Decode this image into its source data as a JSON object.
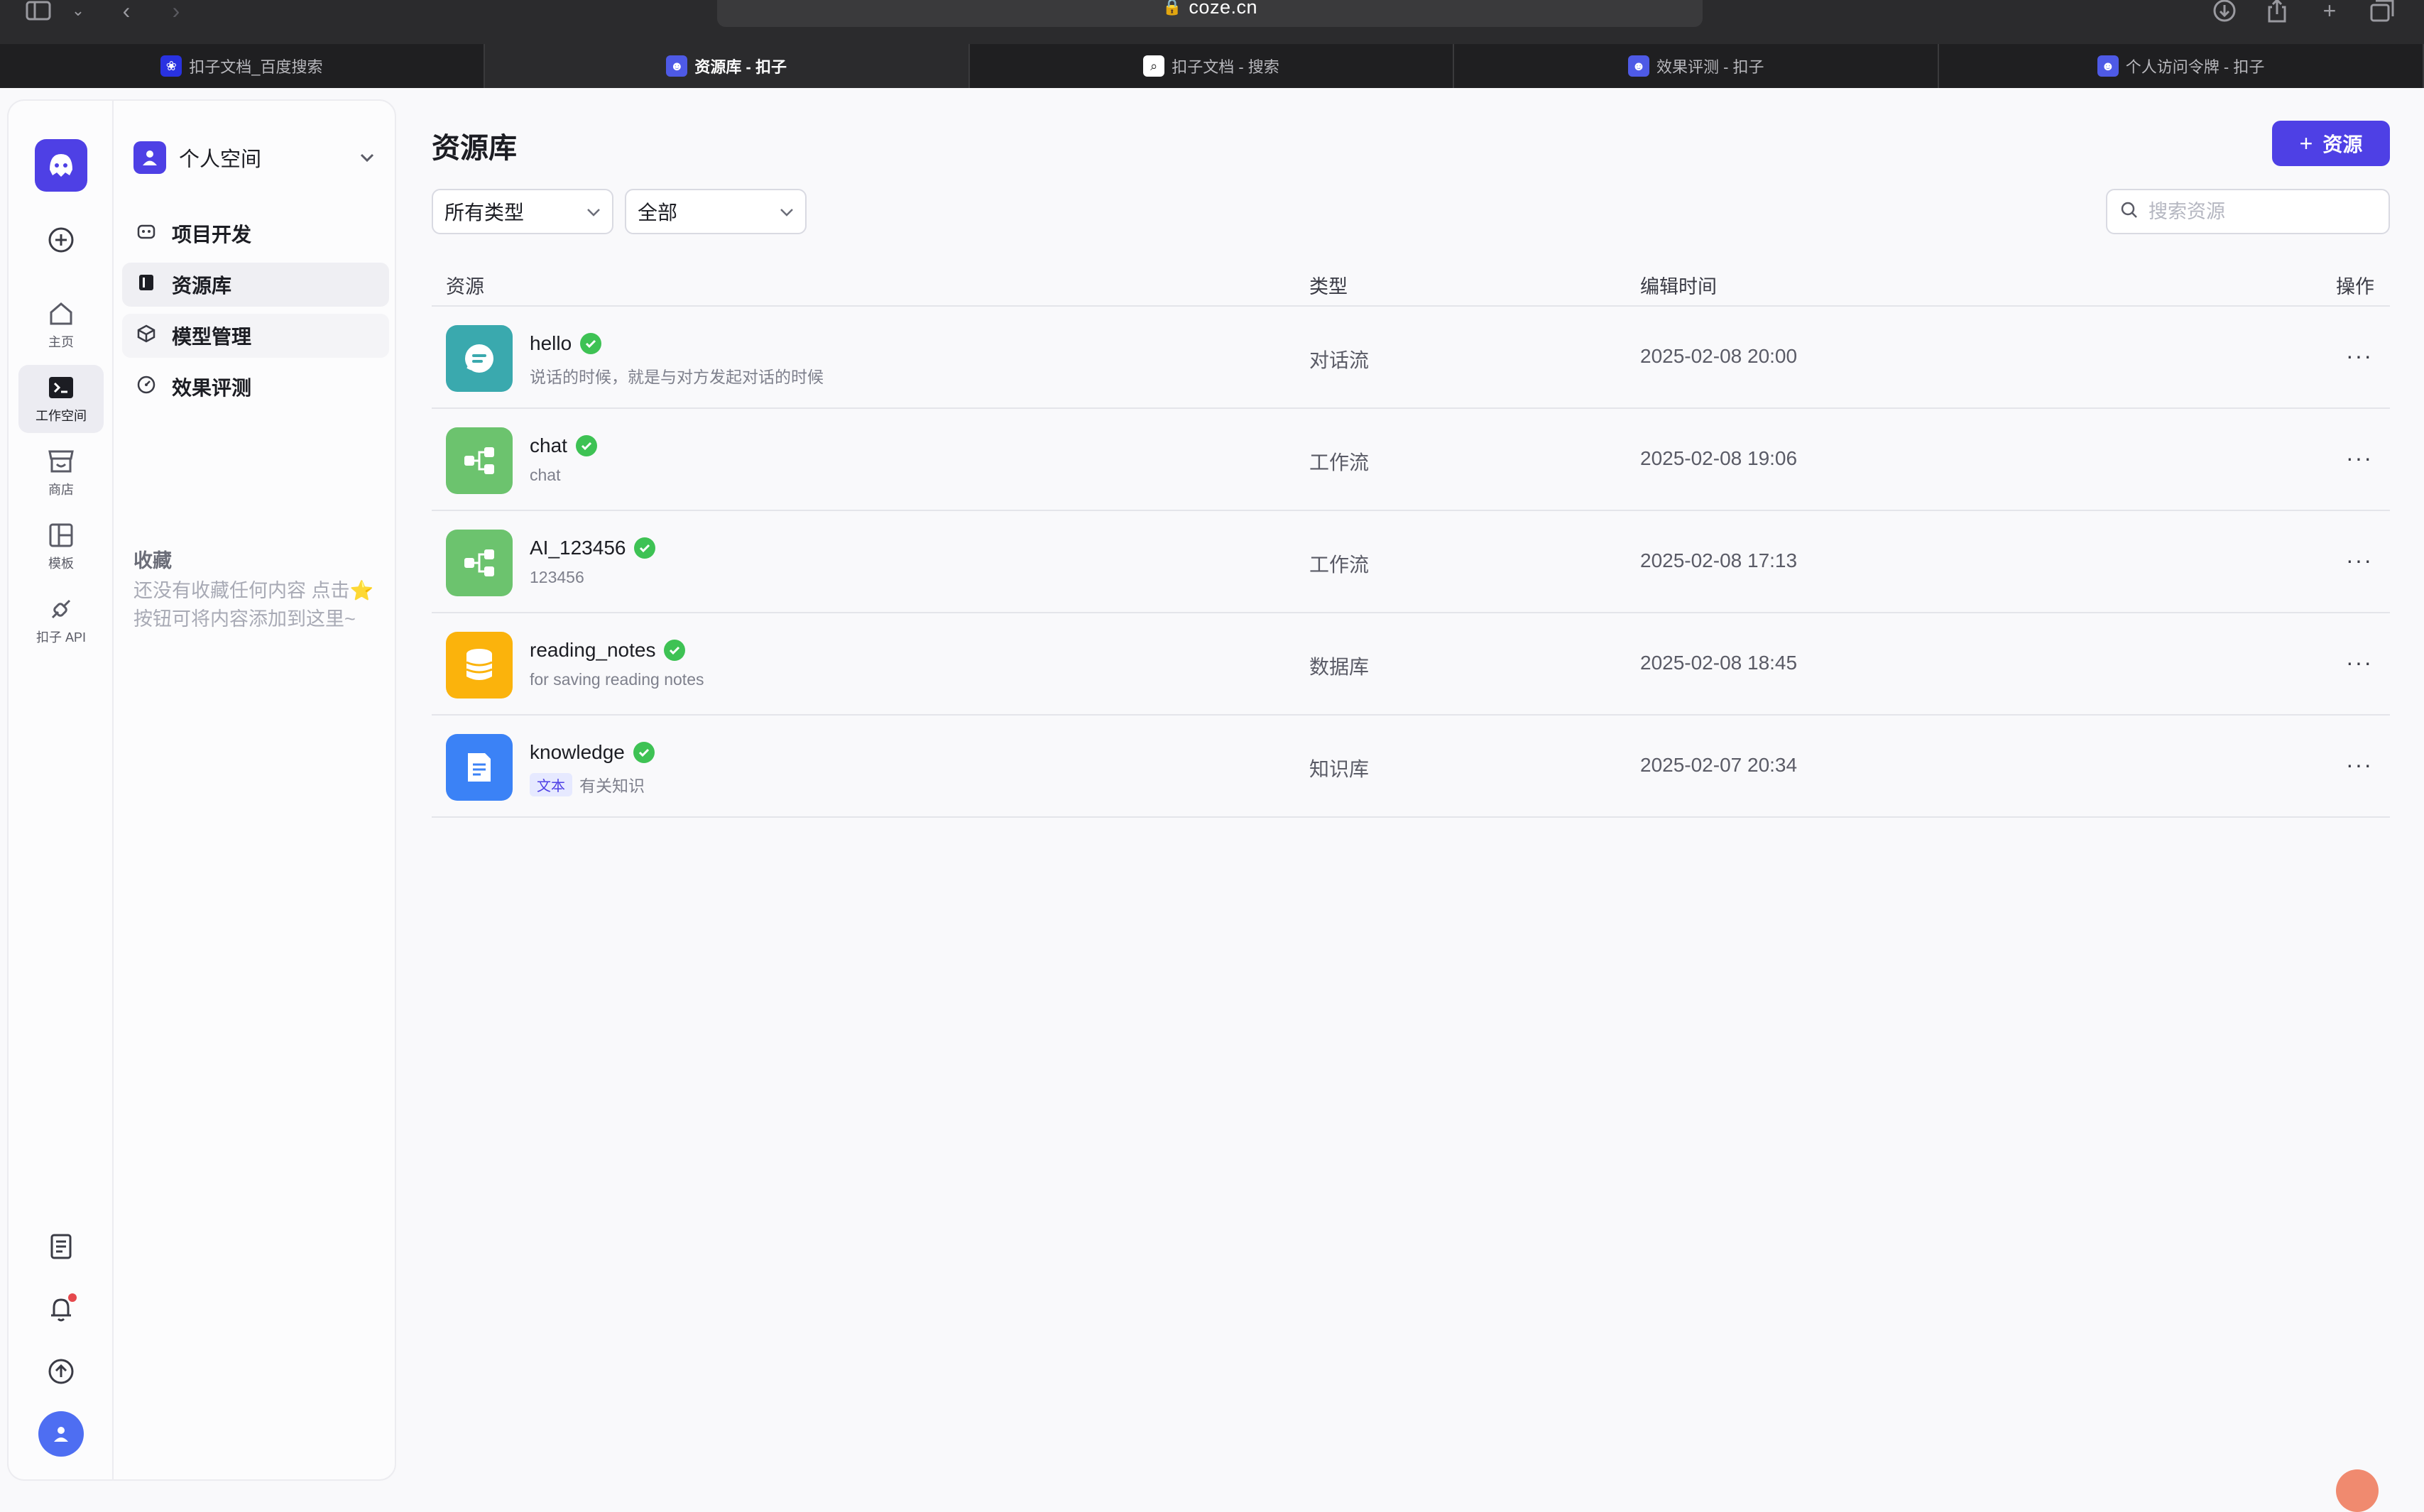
{
  "browser": {
    "address": "coze.cn",
    "tabs": [
      {
        "label": "扣子文档_百度搜索",
        "favicon": "baidu-icon"
      },
      {
        "label": "资源库 - 扣子",
        "favicon": "coze-icon",
        "active": true
      },
      {
        "label": "扣子文档 - 搜索",
        "favicon": "search-icon"
      },
      {
        "label": "效果评测 - 扣子",
        "favicon": "coze-icon"
      },
      {
        "label": "个人访问令牌 - 扣子",
        "favicon": "coze-icon"
      }
    ],
    "close_glyph": "×"
  },
  "rail": {
    "items": [
      {
        "label": "主页",
        "icon": "home-icon"
      },
      {
        "label": "工作空间",
        "icon": "workspace-icon",
        "active": true
      },
      {
        "label": "商店",
        "icon": "store-icon"
      },
      {
        "label": "模板",
        "icon": "template-icon"
      },
      {
        "label": "扣子 API",
        "icon": "api-icon"
      }
    ]
  },
  "sidebar": {
    "space_name": "个人空间",
    "nav": [
      {
        "label": "项目开发",
        "icon": "robot-icon"
      },
      {
        "label": "资源库",
        "icon": "library-icon",
        "active": true
      },
      {
        "label": "模型管理",
        "icon": "cube-icon"
      },
      {
        "label": "效果评测",
        "icon": "gauge-icon"
      }
    ],
    "favorites_title": "收藏",
    "favorites_empty": "还没有收藏任何内容 点击⭐按钮可将内容添加到这里~"
  },
  "main": {
    "title": "资源库",
    "add_button_label": "资源",
    "filter_type": "所有类型",
    "filter_scope": "全部",
    "search_placeholder": "搜索资源",
    "columns": {
      "resource": "资源",
      "type": "类型",
      "edit_time": "编辑时间",
      "actions": "操作"
    },
    "rows": [
      {
        "name": "hello",
        "desc": "说话的时候，就是与对方发起对话的时候",
        "type": "对话流",
        "time": "2025-02-08 20:00",
        "icon": "chatflow-icon",
        "color": "#3aa9ae"
      },
      {
        "name": "chat",
        "desc": "chat",
        "type": "工作流",
        "time": "2025-02-08 19:06",
        "icon": "workflow-icon",
        "color": "#6cc36e"
      },
      {
        "name": "AI_123456",
        "desc": "123456",
        "type": "工作流",
        "time": "2025-02-08 17:13",
        "icon": "workflow-icon",
        "color": "#6cc36e"
      },
      {
        "name": "reading_notes",
        "desc": "for saving reading notes",
        "type": "数据库",
        "time": "2025-02-08 18:45",
        "icon": "database-icon",
        "color": "#fbb30c"
      },
      {
        "name": "knowledge",
        "desc": "有关知识",
        "tag": "文本",
        "type": "知识库",
        "time": "2025-02-07 20:34",
        "icon": "document-icon",
        "color": "#3b82f6"
      }
    ],
    "more_glyph": "···"
  },
  "colors": {
    "brand": "#4e40e5",
    "success": "#3ec254"
  }
}
